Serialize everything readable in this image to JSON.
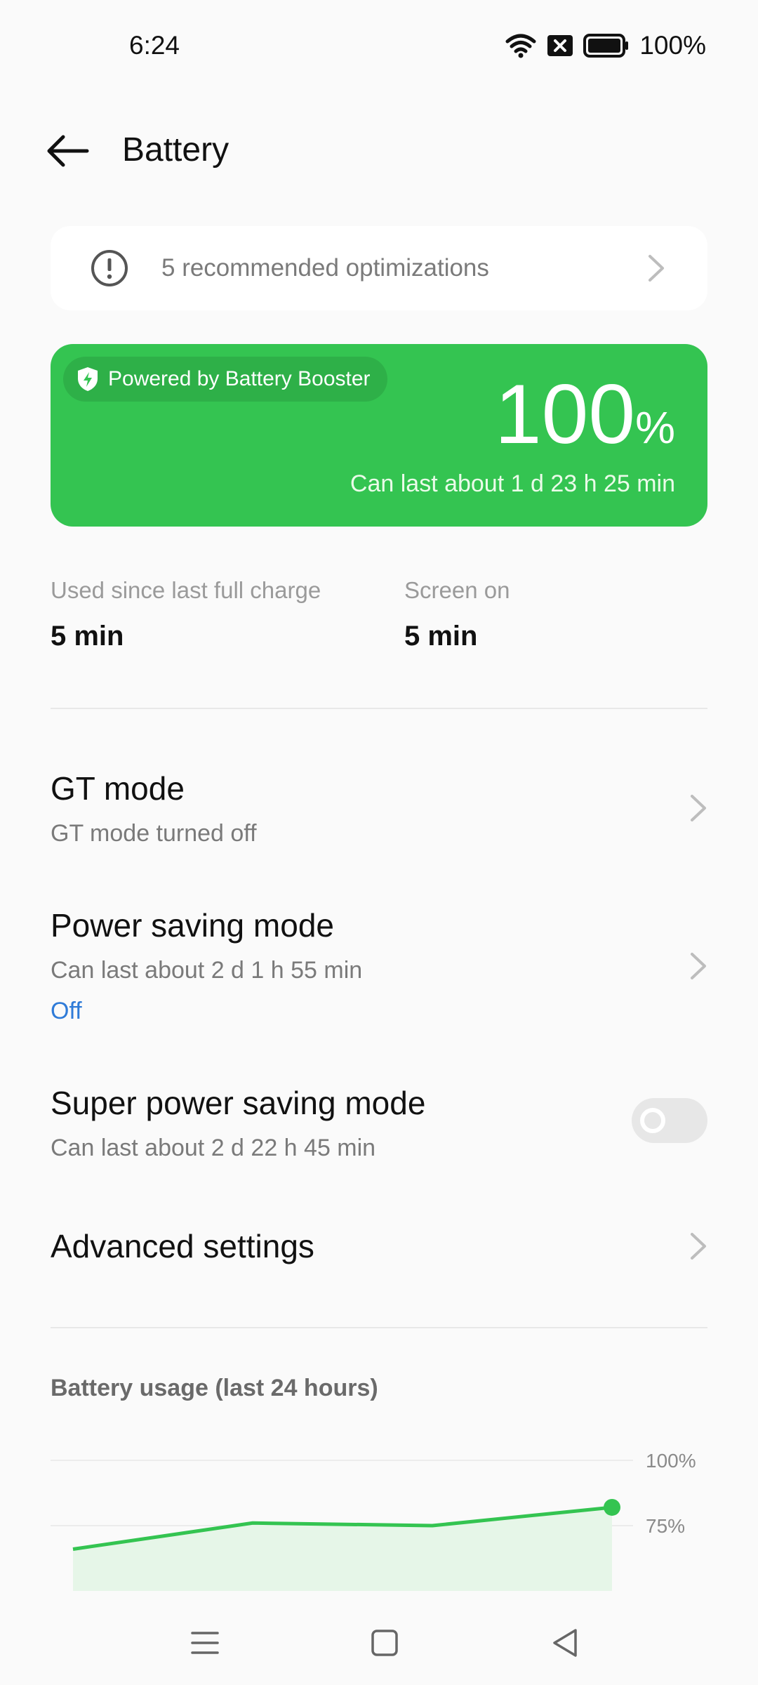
{
  "status_bar": {
    "time": "6:24",
    "battery_pct": "100%",
    "icons": [
      "wifi-icon",
      "sim-disabled-icon",
      "battery-icon"
    ]
  },
  "header": {
    "title": "Battery",
    "back_icon": "arrow-left-icon"
  },
  "optimizations": {
    "text": "5 recommended optimizations",
    "icon": "info-circle-icon"
  },
  "battery_card": {
    "badge": "Powered by Battery Booster",
    "percent": "100",
    "percent_unit": "%",
    "estimate": "Can last about 1 d 23 h 25 min",
    "color": "#34c451"
  },
  "stats": [
    {
      "label": "Used since last full charge",
      "value": "5 min"
    },
    {
      "label": "Screen on",
      "value": "5 min"
    }
  ],
  "settings": [
    {
      "title": "GT mode",
      "subtitle": "GT mode turned off"
    },
    {
      "title": "Power saving mode",
      "subtitle": "Can last about 2 d 1 h 55 min",
      "status": "Off"
    },
    {
      "title": "Super power saving mode",
      "subtitle": "Can last about 2 d 22 h 45 min",
      "toggle": false
    },
    {
      "title": "Advanced settings"
    }
  ],
  "usage": {
    "title": "Battery usage (last 24 hours)"
  },
  "chart_data": {
    "type": "area",
    "title": "Battery usage (last 24 hours)",
    "y_tick_labels": [
      "100%",
      "75%"
    ],
    "ylim": [
      50,
      100
    ],
    "x": [
      0,
      1,
      2,
      3
    ],
    "values": [
      66,
      76,
      75,
      82
    ],
    "color": "#34c451",
    "grid": true
  },
  "nav": {
    "icons": [
      "menu-icon",
      "home-square-icon",
      "back-triangle-icon"
    ]
  }
}
